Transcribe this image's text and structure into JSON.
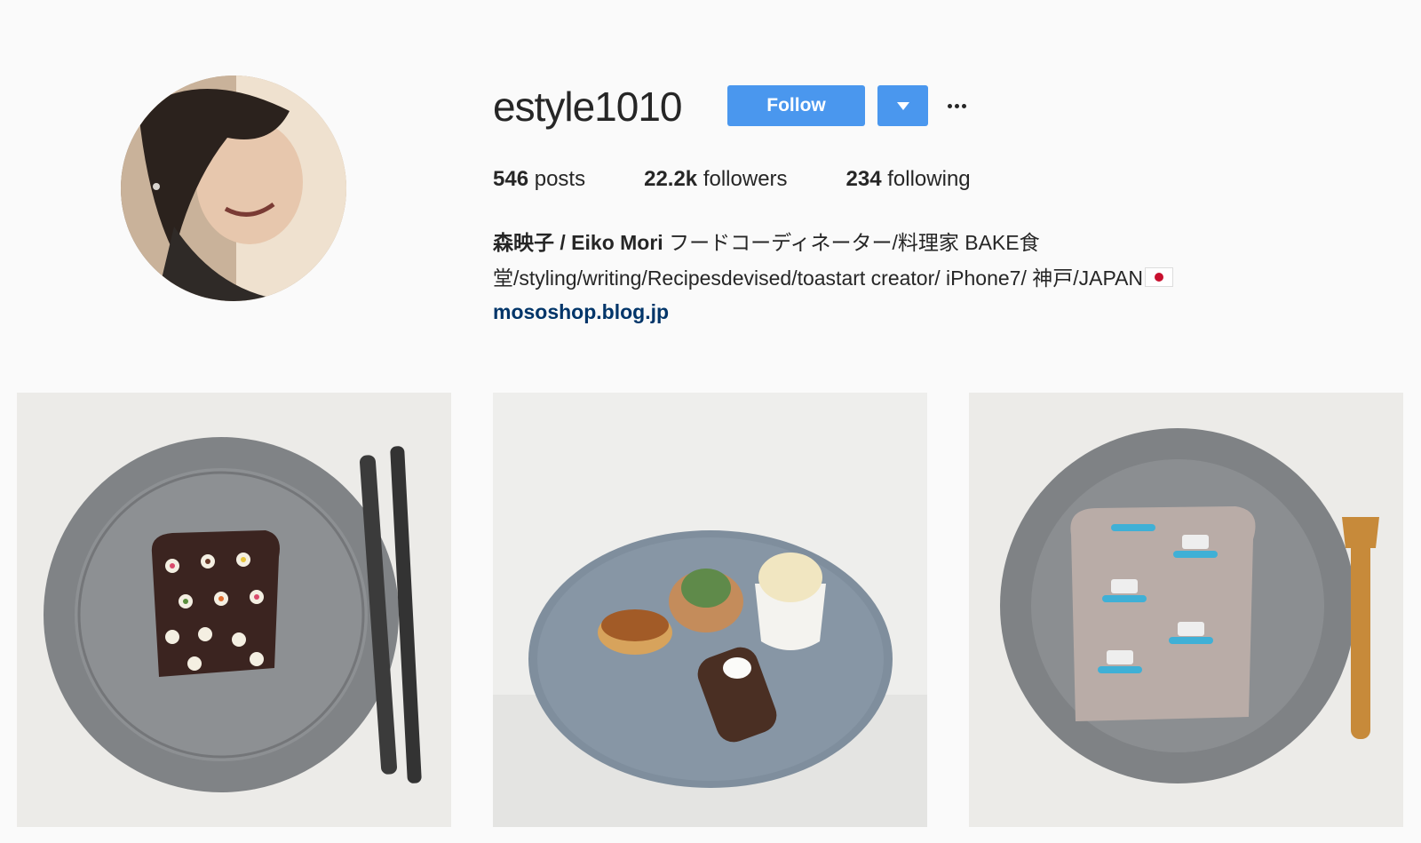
{
  "profile": {
    "username": "estyle1010",
    "follow_label": "Follow",
    "dropdown_icon": "caret-down-icon",
    "more_icon": "ellipsis-icon",
    "avatar_alt": "profile photo"
  },
  "stats": {
    "posts_count": "546",
    "posts_label": "posts",
    "followers_count": "22.2k",
    "followers_label": "followers",
    "following_count": "234",
    "following_label": "following"
  },
  "bio": {
    "name": "森映子 / Eiko Mori",
    "description_line1": " フードコーディネーター/料理家 BAKE食",
    "description_line2": "堂/styling/writing/Recipesdevised/toastart creator/ iPhone7/ 神戸/JAPAN",
    "flag_icon": "japan-flag-icon",
    "link": "mososhop.blog.jp"
  },
  "colors": {
    "accent": "#4a97ee",
    "link": "#003569",
    "background": "#fafafa"
  },
  "posts": [
    {
      "description": "chocolate toast with flowers on grey plate"
    },
    {
      "description": "sweets plate with tarts and cake"
    },
    {
      "description": "toast with ship decorations on grey plate"
    }
  ]
}
